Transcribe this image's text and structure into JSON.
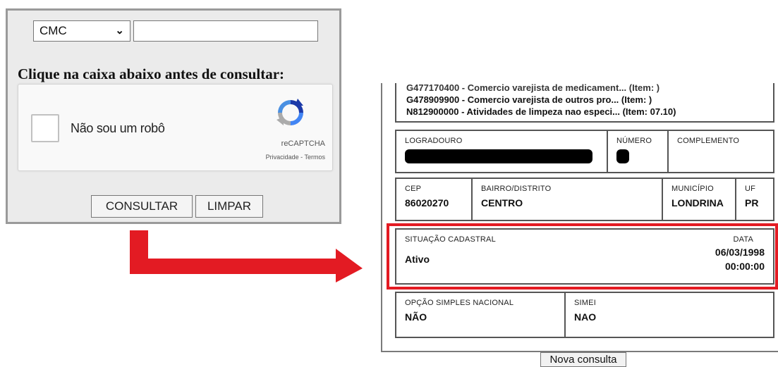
{
  "form": {
    "select_value": "CMC",
    "code_input_value": "",
    "instruction": "Clique na caixa abaixo antes de consultar:",
    "captcha_label": "Não sou um robô",
    "recaptcha_brand": "reCAPTCHA",
    "recaptcha_links": "Privacidade - Termos",
    "consultar_label": "CONSULTAR",
    "limpar_label": "LIMPAR"
  },
  "result": {
    "cnae_lines": [
      "G477170400 - Comercio varejista de medicament... (Item: )",
      "G478909900 - Comercio varejista de outros pro... (Item: )",
      "N812900000 - Atividades de limpeza nao especi... (Item: 07.10)"
    ],
    "address": {
      "logradouro_label": "LOGRADOURO",
      "numero_label": "NÚMERO",
      "complemento_label": "COMPLEMENTO"
    },
    "location": {
      "cep_label": "CEP",
      "cep_value": "86020270",
      "bairro_label": "BAIRRO/DISTRITO",
      "bairro_value": "CENTRO",
      "municipio_label": "MUNICÍPIO",
      "municipio_value": "LONDRINA",
      "uf_label": "UF",
      "uf_value": "PR"
    },
    "situacao": {
      "label": "SITUAÇÃO CADASTRAL",
      "value": "Ativo",
      "data_label": "DATA",
      "data_date": "06/03/1998",
      "data_time": "00:00:00"
    },
    "simples": {
      "opcao_label": "OPÇÃO SIMPLES NACIONAL",
      "opcao_value": "NÃO",
      "simei_label": "SIMEI",
      "simei_value": "NAO"
    },
    "nova_consulta_label": "Nova consulta"
  },
  "colors": {
    "highlight": "#e31b23",
    "arrow": "#e31b23"
  },
  "icons": [
    "chevron-down-icon",
    "recaptcha-logo-icon",
    "red-arrow-icon"
  ]
}
